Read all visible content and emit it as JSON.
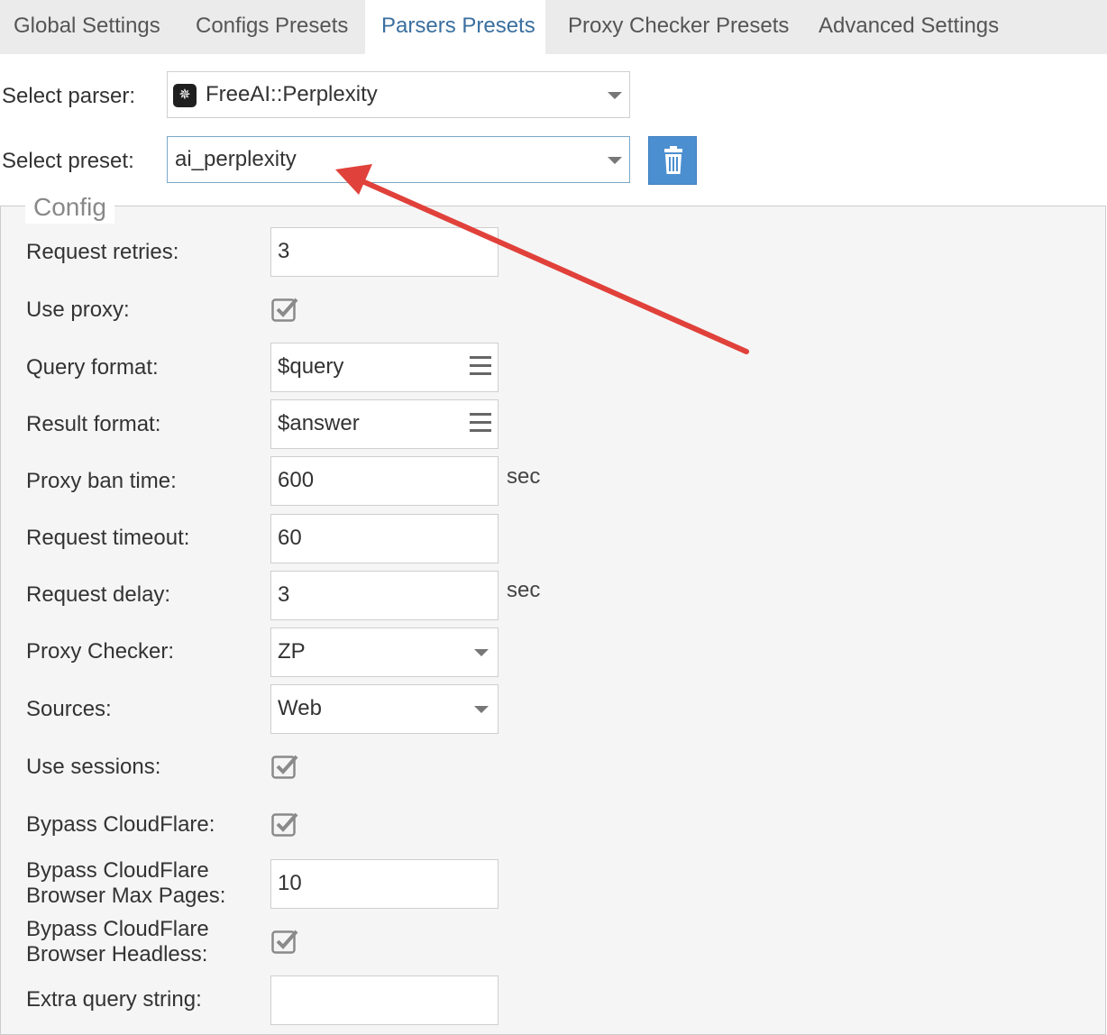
{
  "tabs": [
    {
      "label": "Global Settings"
    },
    {
      "label": "Configs Presets"
    },
    {
      "label": "Parsers Presets"
    },
    {
      "label": "Proxy Checker Presets"
    },
    {
      "label": "Advanced Settings"
    }
  ],
  "active_tab": "Parsers Presets",
  "parser": {
    "label": "Select parser:",
    "value": "FreeAI::Perplexity",
    "icon": "perplexity-logo-icon"
  },
  "preset": {
    "label": "Select preset:",
    "value": "ai_perplexity",
    "delete_icon": "trash-icon"
  },
  "config": {
    "legend": "Config",
    "request_retries": {
      "label": "Request retries:",
      "value": "3"
    },
    "use_proxy": {
      "label": "Use proxy:",
      "checked": true
    },
    "query_format": {
      "label": "Query format:",
      "value": "$query"
    },
    "result_format": {
      "label": "Result format:",
      "value": "$answer"
    },
    "proxy_ban_time": {
      "label": "Proxy ban time:",
      "value": "600",
      "unit": "sec"
    },
    "request_timeout": {
      "label": "Request timeout:",
      "value": "60"
    },
    "request_delay": {
      "label": "Request delay:",
      "value": "3",
      "unit": "sec"
    },
    "proxy_checker": {
      "label": "Proxy Checker:",
      "value": "ZP"
    },
    "sources": {
      "label": "Sources:",
      "value": "Web"
    },
    "use_sessions": {
      "label": "Use sessions:",
      "checked": true
    },
    "bypass_cloudflare": {
      "label": "Bypass CloudFlare:",
      "checked": true
    },
    "bypass_cf_max_pages": {
      "label_line1": "Bypass CloudFlare",
      "label_line2": "Browser Max Pages:",
      "value": "10"
    },
    "bypass_cf_headless": {
      "label_line1": "Bypass CloudFlare",
      "label_line2": "Browser Headless:",
      "checked": true
    },
    "extra_query_string": {
      "label": "Extra query string:",
      "value": ""
    }
  },
  "colors": {
    "accent": "#4b8fd0",
    "annotation_arrow": "#e0413a"
  }
}
